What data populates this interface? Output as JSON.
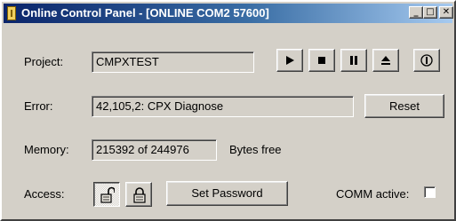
{
  "window": {
    "title": "Online Control Panel - [ONLINE COM2 57600]",
    "minimize_glyph": "_",
    "maximize_glyph": "□",
    "close_glyph": "✕"
  },
  "project": {
    "label": "Project:",
    "value": "CMPXTEST"
  },
  "controls": [
    "play-icon",
    "stop-icon",
    "pause-icon",
    "eject-icon",
    "info-icon"
  ],
  "error": {
    "label": "Error:",
    "value": "42,105,2: CPX Diagnose",
    "reset_label": "Reset"
  },
  "memory": {
    "label": "Memory:",
    "value": "215392 of 244976",
    "suffix": "Bytes free"
  },
  "access": {
    "label": "Access:",
    "unlocked_icon": "unlocked-padlock-icon",
    "locked_icon": "locked-padlock-icon",
    "set_password_label": "Set Password",
    "comm_label": "COMM active:",
    "comm_active": false
  }
}
